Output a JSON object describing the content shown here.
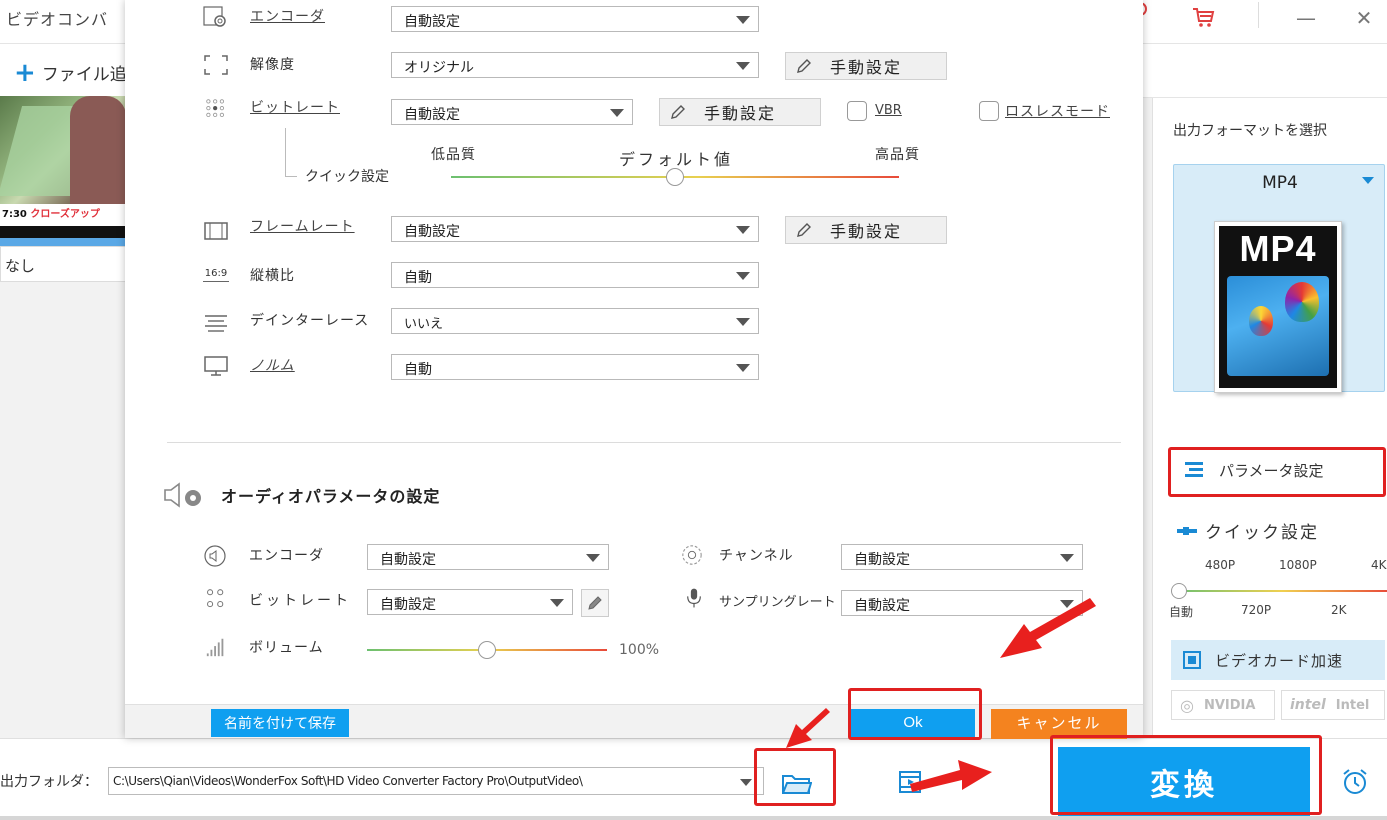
{
  "app": {
    "title": "ビデオコンバ",
    "add_file": "ファイル追",
    "thumb_time": "7:30",
    "thumb_caption": "クローズアップ",
    "subtitle_value": "なし"
  },
  "dialog": {
    "video": {
      "encoder_label": "エンコーダ",
      "encoder_value": "自動設定",
      "resolution_label": "解像度",
      "resolution_value": "オリジナル",
      "manual": "手動設定",
      "bitrate_label": "ビットレート",
      "bitrate_value": "自動設定",
      "vbr_label": "VBR",
      "lossless_label": "ロスレスモード",
      "quick_setting_label": "クイック設定",
      "quality_low": "低品質",
      "quality_default": "デフォルト値",
      "quality_high": "高品質",
      "framerate_label": "フレームレート",
      "framerate_value": "自動設定",
      "aspect_label": "縦横比",
      "aspect_value": "自動",
      "aspect_icon_text": "16:9",
      "deinterlace_label": "デインターレース",
      "deinterlace_value": "いいえ",
      "norm_label": "ノルム",
      "norm_value": "自動"
    },
    "audio": {
      "title": "オーディオパラメータの設定",
      "encoder_label": "エンコーダ",
      "encoder_value": "自動設定",
      "channel_label": "チャンネル",
      "channel_value": "自動設定",
      "bitrate_label": "ビットレート",
      "bitrate_value": "自動設定",
      "samplerate_label": "サンプリングレート",
      "samplerate_value": "自動設定",
      "volume_label": "ボリューム",
      "volume_value": "100%",
      "volume_level": 0.5
    },
    "buttons": {
      "save_as": "名前を付けて保存",
      "ok": "Ok",
      "cancel": "キャンセル"
    },
    "quality_level": 0.5
  },
  "right_panel": {
    "output_format_title": "出力フォーマットを選択",
    "format_name": "MP4",
    "format_card_text": "MP4",
    "param_settings": "パラメータ設定",
    "quick_settings": "クイック設定",
    "quick_top": [
      "480P",
      "1080P",
      "4K"
    ],
    "quick_bottom": [
      "自動",
      "720P",
      "2K"
    ],
    "gpu_accel": "ビデオカード加速",
    "vendors": [
      "NVIDIA",
      "Intel"
    ]
  },
  "bottom": {
    "output_folder_label": "出力フォルダ：",
    "output_path": "C:\\Users\\Qian\\Videos\\WonderFox Soft\\HD Video Converter Factory Pro\\OutputVideo\\",
    "convert": "変換"
  },
  "colors": {
    "accent": "#0f9ff0",
    "cancel": "#f4831f",
    "annotation": "#e02020"
  }
}
